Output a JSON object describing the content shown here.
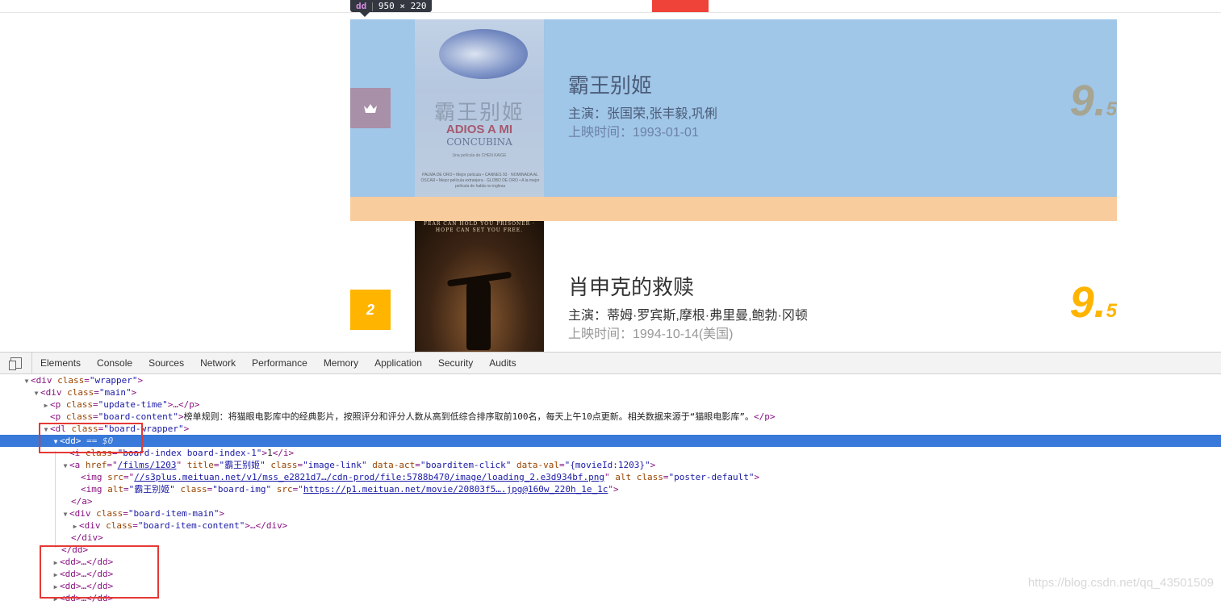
{
  "overlay": {
    "tooltip_tag": "dd",
    "tooltip_size": "950 × 220"
  },
  "movies": [
    {
      "rank": "",
      "name": "霸王别姬",
      "star": "主演：张国荣,张丰毅,巩俐",
      "release": "上映时间：1993-01-01",
      "score_int": "9.",
      "score_frac": "5",
      "poster_text": {
        "title_cn": "霸王别姬",
        "title_en1": "ADIOS A MI",
        "title_en2": "CONCUBINA",
        "credit": "Una película de CHEN KAIGE",
        "awards": "PALMA DE ORO • Mejor película • CANNES 93 · NOMINADA AL OSCAR • Mejor película extranjera · GLOBO DE ORO • A la mejor película de habla no inglesa"
      }
    },
    {
      "rank": "2",
      "name": "肖申克的救赎",
      "star": "主演：蒂姆·罗宾斯,摩根·弗里曼,鲍勃·冈顿",
      "release": "上映时间：1994-10-14(美国)",
      "score_int": "9.",
      "score_frac": "5",
      "poster_text": {
        "tagline": "FEAR CAN HOLD YOU PRISONER · HOPE CAN SET YOU FREE."
      }
    }
  ],
  "devtools": {
    "tabs": [
      "Elements",
      "Console",
      "Sources",
      "Network",
      "Performance",
      "Memory",
      "Application",
      "Security",
      "Audits"
    ],
    "lines": {
      "l1_tag": "<div",
      "l1_attr": " class",
      "l1_val": "\"wrapper\"",
      "l1_close": ">",
      "l2_tag": "<div",
      "l2_attr": " class",
      "l2_val": "\"main\"",
      "l2_close": ">",
      "l3_tag": "<p",
      "l3_attr": " class",
      "l3_val": "\"update-time\"",
      "l3_close": ">…</p>",
      "l4_tag": "<p",
      "l4_attr": " class",
      "l4_val": "\"board-content\"",
      "l4_close": ">",
      "l4_text": "榜单规则：将猫眼电影库中的经典影片，按照评分和评分人数从高到低综合排序取前100名，每天上午10点更新。相关数据来源于“猫眼电影库”。",
      "l4_end": "</p>",
      "l5_tag": "<dl",
      "l5_attr": " class",
      "l5_val": "\"board-wrapper\"",
      "l5_close": ">",
      "l6_tag": "<dd>",
      "l6_eq": " == $0",
      "l7_tag": "<i",
      "l7_attr": " class",
      "l7_val": "\"board-index board-index-1\"",
      "l7_close": ">",
      "l7_text": "1",
      "l7_end": "</i>",
      "l8_tag": "<a",
      "l8_a1": " href",
      "l8_v1": "/films/1203",
      "l8_a2": " title",
      "l8_v2": "\"霸王别姬\"",
      "l8_a3": " class",
      "l8_v3": "\"image-link\"",
      "l8_a4": " data-act",
      "l8_v4": "\"boarditem-click\"",
      "l8_a5": " data-val",
      "l8_v5": "\"{movieId:1203}\"",
      "l8_close": ">",
      "l9_tag": "<img",
      "l9_a1": " src",
      "l9_v1": "//s3plus.meituan.net/v1/mss_e2821d7…/cdn-prod/file:5788b470/image/loading_2.e3d934bf.png",
      "l9_a2": " alt class",
      "l9_v2": "\"poster-default\"",
      "l9_close": ">",
      "l10_tag": "<img",
      "l10_a1": " alt",
      "l10_v1": "\"霸王别姬\"",
      "l10_a2": " class",
      "l10_v2": "\"board-img\"",
      "l10_a3": " src",
      "l10_v3": "https://p1.meituan.net/movie/20803f5….jpg@160w_220h_1e_1c",
      "l10_close": ">",
      "l11": "</a>",
      "l12_tag": "<div",
      "l12_attr": " class",
      "l12_val": "\"board-item-main\"",
      "l12_close": ">",
      "l13_tag": "<div",
      "l13_attr": " class",
      "l13_val": "\"board-item-content\"",
      "l13_close": ">…</div>",
      "l14": "</div>",
      "l15": "</dd>",
      "l16": "<dd>…</dd>",
      "l17": "<dd>…</dd>",
      "l18": "<dd>…</dd>",
      "l19": "<dd>…</dd>"
    }
  },
  "watermark": "https://blog.csdn.net/qq_43501509",
  "colors": {
    "highlight_content": "#6fa8dc",
    "highlight_margin": "#f6b26b",
    "rank_gold": "#ffb400",
    "selection": "#3879d9",
    "annotation_red": "#e53935"
  }
}
